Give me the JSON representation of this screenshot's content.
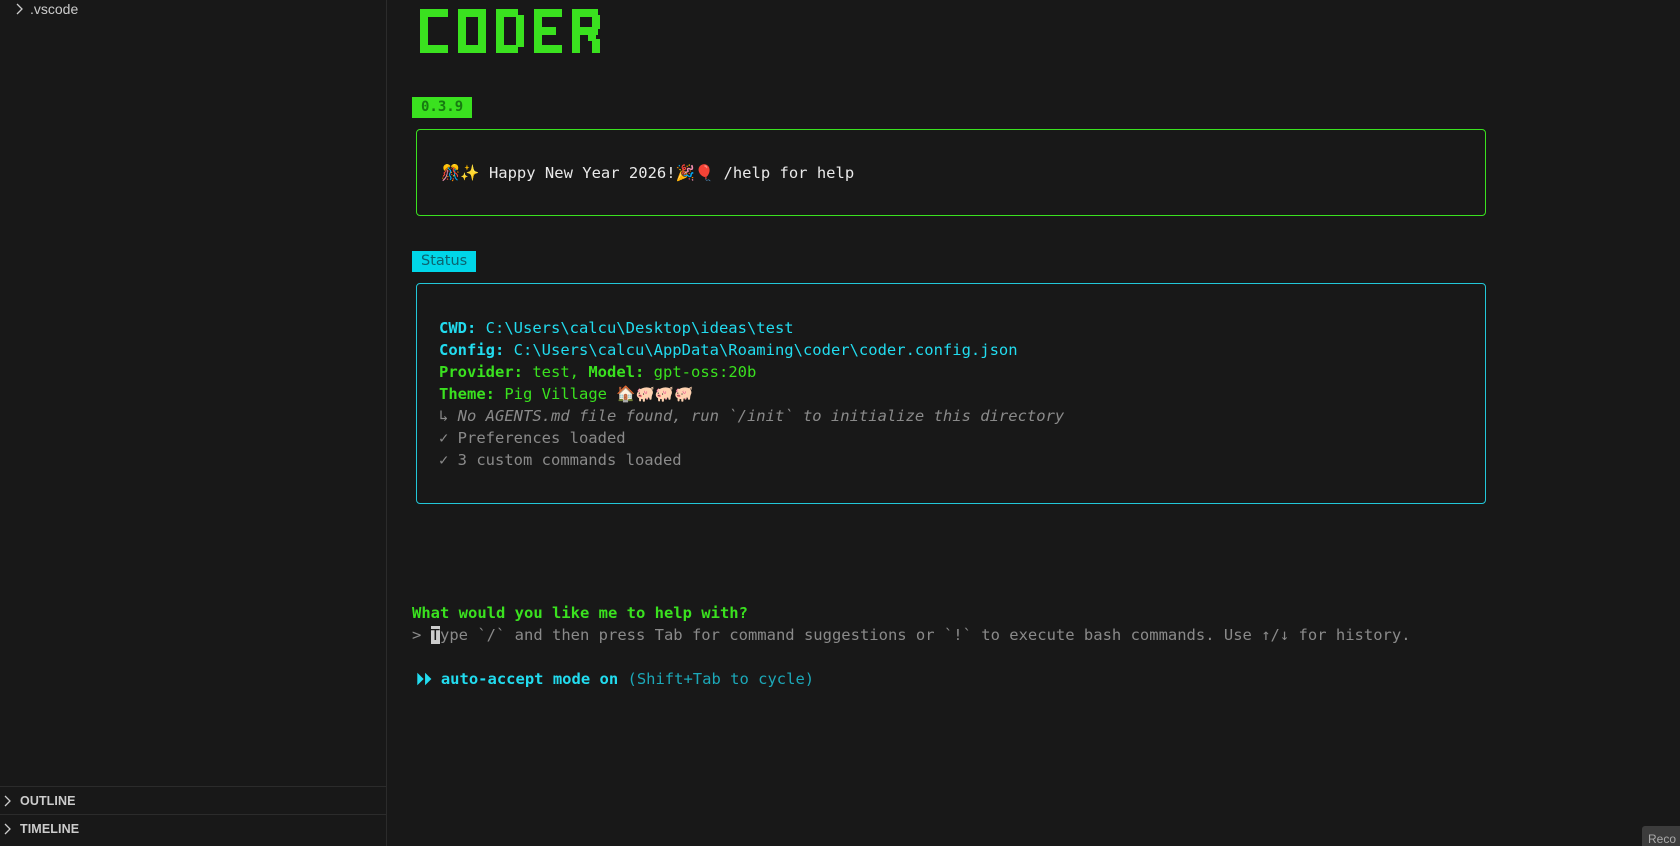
{
  "sidebar": {
    "folder_item": ".vscode",
    "sections": [
      {
        "label": "OUTLINE"
      },
      {
        "label": "TIMELINE"
      }
    ]
  },
  "terminal": {
    "logo_text": "CODER",
    "version": "0.3.9",
    "welcome": {
      "prefix_emoji": "🎊✨",
      "message": " Happy New Year 2026!",
      "suffix_emoji": "🎉🎈",
      "help": " /help for help"
    },
    "status": {
      "title": "Status",
      "cwd_label": "CWD:",
      "cwd_value": " C:\\Users\\calcu\\Desktop\\ideas\\test",
      "config_label": "Config:",
      "config_value": " C:\\Users\\calcu\\AppData\\Roaming\\coder\\coder.config.json",
      "provider_label": "Provider:",
      "provider_value": " test,",
      "model_label": " Model:",
      "model_value": " gpt-oss:20b",
      "theme_label": "Theme:",
      "theme_value": " Pig Village ",
      "theme_emoji": "🏠🐖🐖🐖",
      "agents_notice": "↳ No AGENTS.md file found, run `/init` to initialize this directory",
      "prefs_loaded": "✓ Preferences loaded",
      "commands_loaded": "✓ 3 custom commands loaded"
    },
    "prompt_question": "What would you like me to help with?",
    "input": {
      "prompt_symbol": "> ",
      "caret_char": "T",
      "placeholder_rest": "ype `/` and then press Tab for command suggestions or `!` to execute bash commands. Use ↑/↓ for history."
    },
    "mode": {
      "icon": "⏵⏵",
      "label": " auto-accept mode on ",
      "hint": "(Shift+Tab to cycle)"
    }
  },
  "corner_tab": "Reco",
  "colors": {
    "background": "#181818",
    "green_accent": "#3ae11f",
    "cyan_accent": "#22dcef",
    "dim_text": "#8a8a8a"
  }
}
